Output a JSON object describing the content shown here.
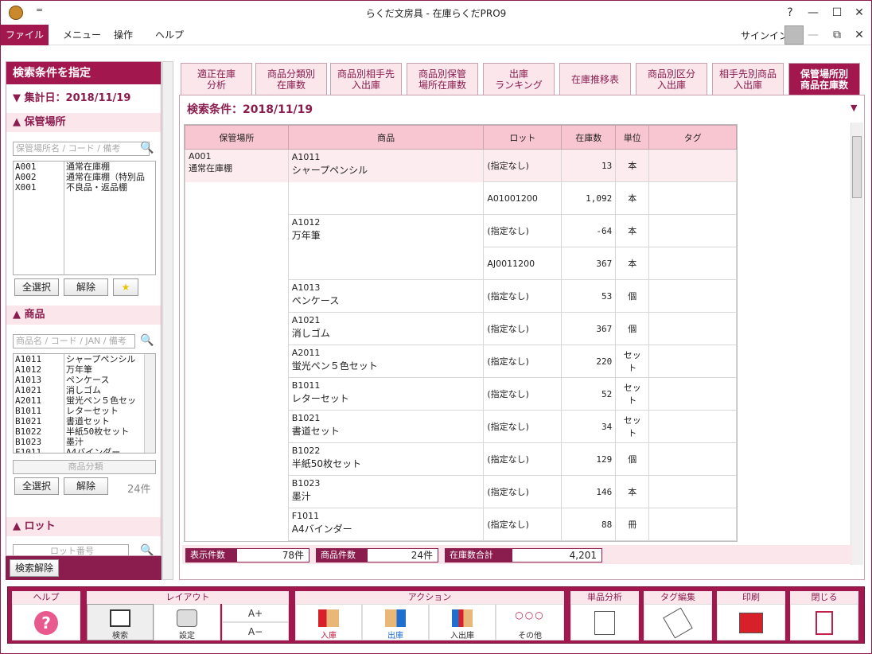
{
  "window": {
    "title": "らくだ文房具 - 在庫らくだPRO9",
    "help_glyph": "?",
    "min_glyph": "—",
    "max_glyph": "☐",
    "close_glyph": "✕",
    "quick_access": "="
  },
  "menu": {
    "items": [
      "ファイル",
      "メニュー",
      "操作",
      "ヘルプ"
    ],
    "signin": "サインイン",
    "restore_glyph": "⧉"
  },
  "left": {
    "header": "検索条件を指定",
    "date_label": "集計日：2018/11/19",
    "location": {
      "title": "保管場所",
      "search_placeholder": "保管場所名 / コード / 備考",
      "codes": [
        "A001",
        "A002",
        "X001"
      ],
      "names": [
        "通常在庫棚",
        "通常在庫棚（特別品",
        "不良品・返品棚"
      ],
      "select_all": "全選択",
      "clear": "解除",
      "star": "★"
    },
    "product": {
      "title": "商品",
      "search_placeholder": "商品名 / コード / JAN / 備考",
      "codes": [
        "A1011",
        "A1012",
        "A1013",
        "A1021",
        "A2011",
        "B1011",
        "B1021",
        "B1022",
        "B1023",
        "F1011"
      ],
      "names": [
        "シャープペンシル",
        "万年筆",
        "ペンケース",
        "消しゴム",
        "蛍光ペン５色セッ",
        "レターセット",
        "書道セット",
        "半紙50枚セット",
        "墨汁",
        "A4バインダー"
      ],
      "category_placeholder": "商品分類",
      "select_all": "全選択",
      "clear": "解除",
      "count": "24件"
    },
    "lot": {
      "title": "ロット",
      "search_placeholder": "ロット番号"
    },
    "clear_search": "検索解除"
  },
  "tabs": [
    {
      "l1": "適正在庫",
      "l2": "分析"
    },
    {
      "l1": "商品分類別",
      "l2": "在庫数"
    },
    {
      "l1": "商品別相手先",
      "l2": "入出庫"
    },
    {
      "l1": "商品別保管",
      "l2": "場所在庫数"
    },
    {
      "l1": "出庫",
      "l2": "ランキング"
    },
    {
      "l1": "在庫推移表",
      "l2": ""
    },
    {
      "l1": "商品別区分",
      "l2": "入出庫"
    },
    {
      "l1": "相手先別商品",
      "l2": "入出庫"
    },
    {
      "l1": "保管場所別",
      "l2": "商品在庫数"
    }
  ],
  "condition": "検索条件：2018/11/19",
  "table": {
    "headers": [
      "保管場所",
      "商品",
      "ロット",
      "在庫数",
      "単位",
      "タグ"
    ],
    "location_code": "A001",
    "location_name": "通常在庫棚",
    "rows": [
      {
        "code": "A1011",
        "name": "シャープペンシル",
        "lot": "(指定なし)",
        "qty": "13",
        "unit": "本"
      },
      {
        "code": "",
        "name": "",
        "lot": "A01001200",
        "qty": "1,092",
        "unit": "本"
      },
      {
        "code": "A1012",
        "name": "万年筆",
        "lot": "(指定なし)",
        "qty": "-64",
        "unit": "本"
      },
      {
        "code": "",
        "name": "",
        "lot": "AJ0011200",
        "qty": "367",
        "unit": "本"
      },
      {
        "code": "A1013",
        "name": "ペンケース",
        "lot": "(指定なし)",
        "qty": "53",
        "unit": "個"
      },
      {
        "code": "A1021",
        "name": "消しゴム",
        "lot": "(指定なし)",
        "qty": "367",
        "unit": "個"
      },
      {
        "code": "A2011",
        "name": "蛍光ペン５色セット",
        "lot": "(指定なし)",
        "qty": "220",
        "unit": "セット"
      },
      {
        "code": "B1011",
        "name": "レターセット",
        "lot": "(指定なし)",
        "qty": "52",
        "unit": "セット"
      },
      {
        "code": "B1021",
        "name": "書道セット",
        "lot": "(指定なし)",
        "qty": "34",
        "unit": "セット"
      },
      {
        "code": "B1022",
        "name": "半紙50枚セット",
        "lot": "(指定なし)",
        "qty": "129",
        "unit": "個"
      },
      {
        "code": "B1023",
        "name": "墨汁",
        "lot": "(指定なし)",
        "qty": "146",
        "unit": "本"
      },
      {
        "code": "F1011",
        "name": "A4バインダー",
        "lot": "(指定なし)",
        "qty": "88",
        "unit": "冊"
      }
    ]
  },
  "summary": {
    "display_label": "表示件数",
    "display_value": "78件",
    "product_label": "商品件数",
    "product_value": "24件",
    "stock_label": "在庫数合計",
    "stock_value": "4,201"
  },
  "bottom": {
    "groups": [
      "ヘルプ",
      "レイアウト",
      "アクション",
      "単品分析",
      "タグ編集",
      "印刷",
      "閉じる"
    ],
    "buttons": {
      "search": "検索",
      "settings": "設定",
      "font_up": "A+",
      "font_down": "A−",
      "in": "入庫",
      "out": "出庫",
      "inout": "入出庫",
      "other": "その他",
      "dots": "○○○"
    }
  },
  "colors": {
    "accent": "#a3174f",
    "dark": "#8a1c4e",
    "light": "#fbe6ec",
    "header": "#f8c6d0"
  }
}
